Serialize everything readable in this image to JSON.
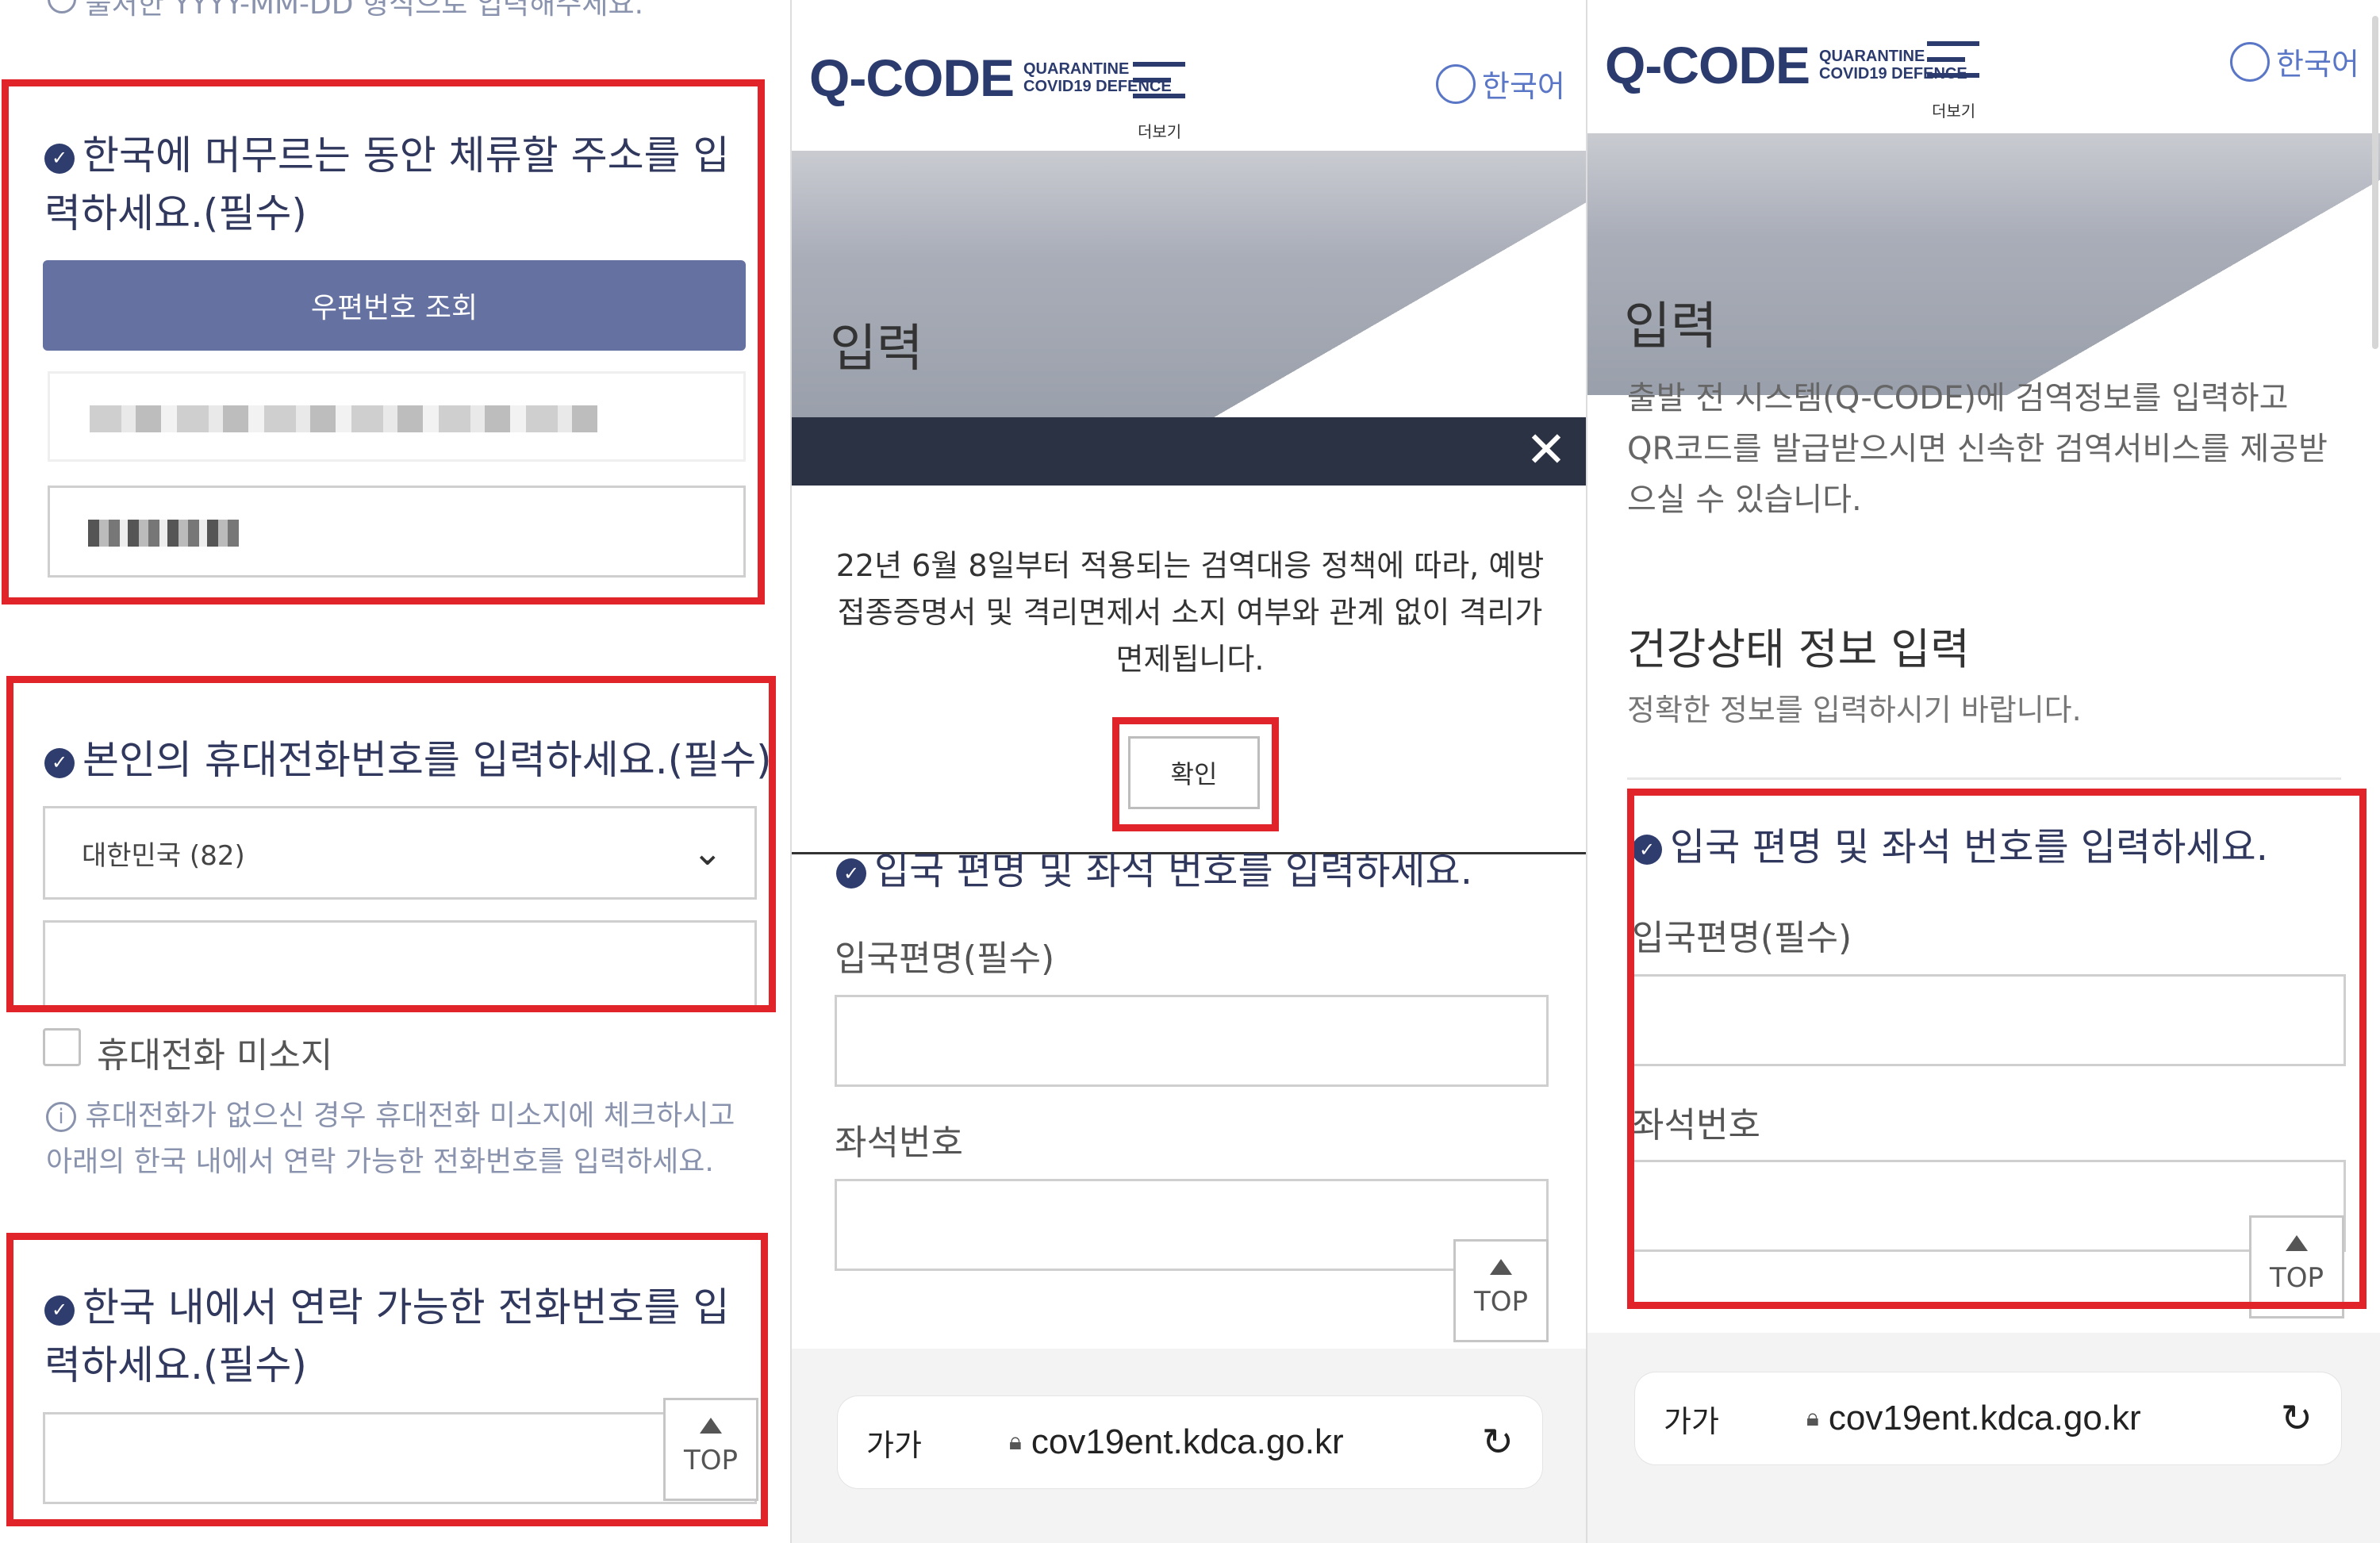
{
  "panel1": {
    "top_partial_text": "출처한 YYYY-MM-DD 형식으로 입력해주세요.",
    "address_question": "한국에 머무르는 동안 체류할 주소를 입력하세요.(필수)",
    "zip_button": "우편번호 조회",
    "phone_question": "본인의 휴대전화번호를 입력하세요.(필수)",
    "country_select": "대한민국 (82)",
    "no_phone_label": "휴대전화 미소지",
    "no_phone_info": "휴대전화가 없으신 경우 휴대전화 미소지에 체크하시고 아래의 한국 내에서 연락 가능한 전화번호를 입력하세요.",
    "contact_question": "한국 내에서 연락 가능한 전화번호를 입력하세요.(필수)",
    "top_label": "TOP"
  },
  "panel2": {
    "logo": "Q-CODE",
    "logo_sub1": "QUARANTINE",
    "logo_sub2": "COVID19 DEFENCE",
    "more_label": "더보기",
    "lang": "한국어",
    "hero_title": "입력",
    "modal_text": "22년 6월 8일부터 적용되는 검역대응 정책에 따라, 예방접종증명서 및 격리면제서 소지 여부와 관계 없이 격리가 면제됩니다.",
    "confirm": "확인",
    "flight_question": "입국 편명 및 좌석 번호를 입력하세요.",
    "flight_label": "입국편명(필수)",
    "seat_label": "좌석번호",
    "top_label": "TOP",
    "text_size": "가가",
    "url": "cov19ent.kdca.go.kr"
  },
  "panel3": {
    "logo": "Q-CODE",
    "logo_sub1": "QUARANTINE",
    "logo_sub2": "COVID19 DEFENCE",
    "more_label": "더보기",
    "lang": "한국어",
    "hero_title": "입력",
    "hero_desc": "출발 전 시스템(Q-CODE)에 검역정보를 입력하고 QR코드를 발급받으시면 신속한 검역서비스를 제공받으실 수 있습니다.",
    "health_title": "건강상태 정보 입력",
    "health_sub": "정확한 정보를 입력하시기 바랍니다.",
    "flight_question": "입국 편명 및 좌석 번호를 입력하세요.",
    "flight_label": "입국편명(필수)",
    "seat_label": "좌석번호",
    "top_label": "TOP",
    "text_size": "가가",
    "url": "cov19ent.kdca.go.kr"
  },
  "colors": {
    "highlight": "#e0242a",
    "navy": "#2e3d6e",
    "button": "#6571a0",
    "modal_header": "#2b3244",
    "link": "#5a76c6"
  },
  "icons": [
    "check-circle-icon",
    "chevron-down-icon",
    "info-icon",
    "globe-icon",
    "menu-icon",
    "close-icon",
    "lock-icon",
    "reload-icon",
    "triangle-up-icon"
  ]
}
